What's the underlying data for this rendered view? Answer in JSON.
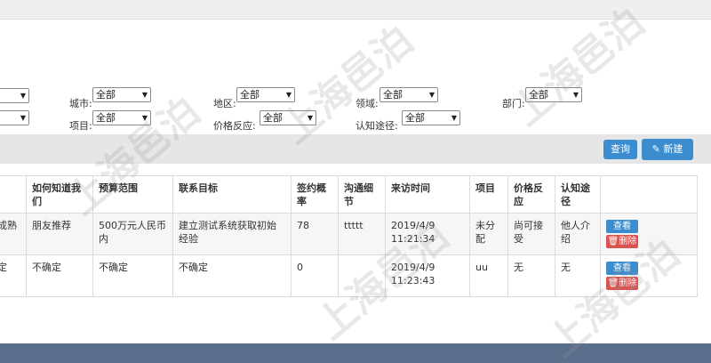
{
  "filters": {
    "city_label": "城市:",
    "city_value": "全部",
    "project_label": "项目:",
    "project_value": "全部",
    "region_label": "地区:",
    "region_value": "全部",
    "price_label": "价格反应:",
    "price_value": "全部",
    "domain_label": "领域:",
    "domain_value": "全部",
    "channel_label": "认知途径:",
    "channel_value": "全部",
    "dept_label": "部门:",
    "dept_value": "全部"
  },
  "toolbar": {
    "query_label": "查询",
    "new_label": "新建",
    "new_icon": "pencil-icon"
  },
  "table": {
    "headers": [
      "如何知道我们",
      "预算范围",
      "联系目标",
      "签约概率",
      "沟通细节",
      "来访时间",
      "项目",
      "价格反应",
      "认知途径",
      ""
    ],
    "rows": [
      {
        "partial": "成熟",
        "how": "朋友推荐",
        "budget": "500万元人民币内",
        "target": "建立测试系统获取初始经验",
        "prob": "78",
        "detail": "ttttt",
        "time": "2019/4/9 11:21:34",
        "project": "未分配",
        "price": "尚可接受",
        "channel": "他人介绍",
        "view_label": "查看",
        "del_label": "删除"
      },
      {
        "partial": "定",
        "how": "不确定",
        "budget": "不确定",
        "target": "不确定",
        "prob": "0",
        "detail": "",
        "time": "2019/4/9 11:23:43",
        "project": "uu",
        "price": "无",
        "channel": "无",
        "view_label": "查看",
        "del_label": "删除"
      }
    ]
  },
  "watermark": "上海邑泊"
}
